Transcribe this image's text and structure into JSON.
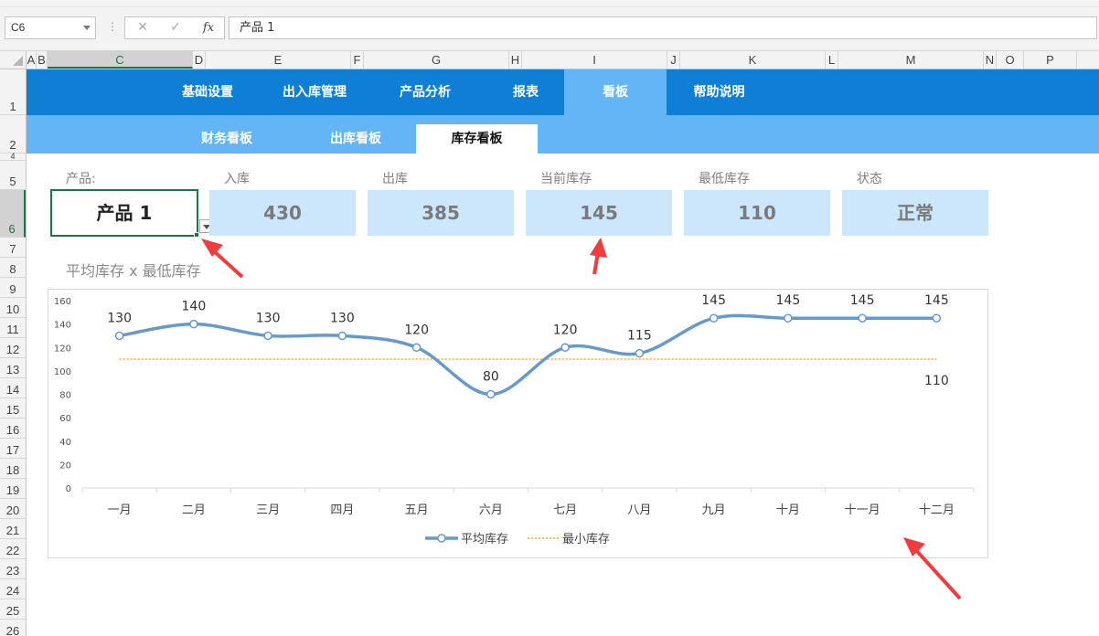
{
  "formula_bar": {
    "name_box": "C6",
    "dots": "⋮",
    "cancel_icon": "✕",
    "enter_icon": "✓",
    "fx_icon": "fx",
    "content": "产品 1"
  },
  "columns": [
    "A",
    "B",
    "C",
    "D",
    "E",
    "F",
    "G",
    "H",
    "I",
    "J",
    "K",
    "L",
    "M",
    "N",
    "O",
    "P"
  ],
  "active_column": "C",
  "rows": [
    "1",
    "2",
    "4",
    "5",
    "6",
    "7",
    "8",
    "9",
    "10",
    "11",
    "12",
    "13",
    "14",
    "15",
    "16",
    "17",
    "18",
    "19",
    "20",
    "21",
    "22",
    "23",
    "24",
    "25",
    "26"
  ],
  "active_row": "6",
  "nav": {
    "items": [
      {
        "label": "基础设置",
        "active": false
      },
      {
        "label": "出入库管理",
        "active": false
      },
      {
        "label": "产品分析",
        "active": false
      },
      {
        "label": "报表",
        "active": false
      },
      {
        "label": "看板",
        "active": true
      },
      {
        "label": "帮助说明",
        "active": false
      }
    ]
  },
  "subnav": {
    "items": [
      {
        "label": "财务看板",
        "active": false
      },
      {
        "label": "出库看板",
        "active": false
      },
      {
        "label": "库存看板",
        "active": true
      }
    ]
  },
  "kpi": {
    "product_label": "产品:",
    "product_value": "产品 1",
    "cards": [
      {
        "label": "入库",
        "value": "430"
      },
      {
        "label": "出库",
        "value": "385"
      },
      {
        "label": "当前库存",
        "value": "145"
      },
      {
        "label": "最低库存",
        "value": "110"
      },
      {
        "label": "状态",
        "value": "正常"
      }
    ]
  },
  "colors": {
    "nav_bg": "#0f7fd6",
    "nav_active": "#64b5f6",
    "kpi_bg": "#cce6fb",
    "line": "#6699cc",
    "min_line": "#f4b400",
    "arrow": "#f03c3c"
  },
  "chart_data": {
    "type": "line",
    "title": "平均库存 x 最低库存",
    "categories": [
      "一月",
      "二月",
      "三月",
      "四月",
      "五月",
      "六月",
      "七月",
      "八月",
      "九月",
      "十月",
      "十一月",
      "十二月"
    ],
    "series": [
      {
        "name": "平均库存",
        "values": [
          130,
          140,
          130,
          130,
          120,
          80,
          120,
          115,
          145,
          145,
          145,
          145
        ],
        "style": "smooth-line-with-markers"
      },
      {
        "name": "最小库存",
        "values": [
          110,
          110,
          110,
          110,
          110,
          110,
          110,
          110,
          110,
          110,
          110,
          110
        ],
        "style": "dotted"
      }
    ],
    "data_labels": {
      "平均库存": "all",
      "最小库存": "last"
    },
    "yticks": [
      0,
      20,
      40,
      60,
      80,
      100,
      120,
      140,
      160
    ],
    "ylim": [
      0,
      160
    ],
    "grid": false,
    "legend": "bottom"
  }
}
